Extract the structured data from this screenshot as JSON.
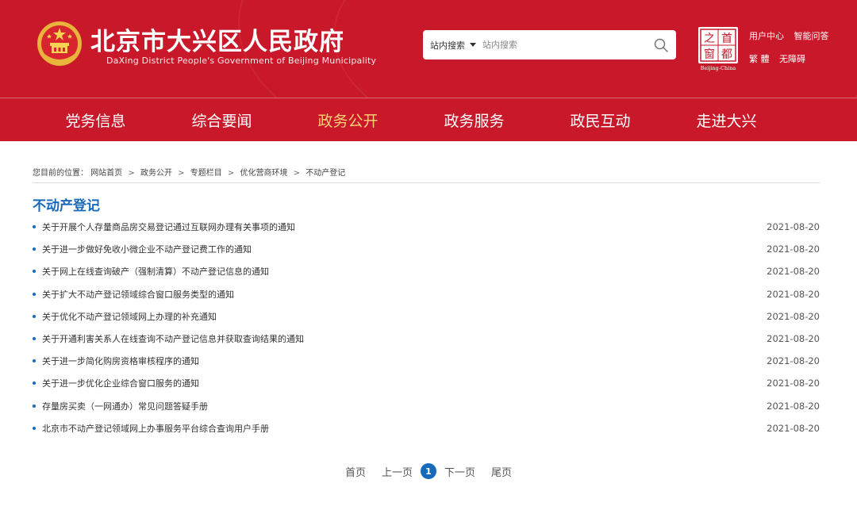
{
  "header": {
    "title": "北京市大兴区人民政府",
    "subtitle": "DaXing District People's Government of Beijing Municipality",
    "emblem_icon": "national-emblem-icon",
    "capital_seal": {
      "chars": [
        "首",
        "都",
        "之",
        "窗"
      ],
      "caption": "Beijing-China"
    },
    "search": {
      "scope_label": "站内搜索",
      "placeholder": "站内搜索",
      "icon": "search-icon"
    },
    "links": {
      "user_center": "用户中心",
      "smart_qa": "智能问答",
      "traditional": "繁 體",
      "accessibility": "无障碍"
    }
  },
  "nav": {
    "items": [
      {
        "label": "党务信息"
      },
      {
        "label": "综合要闻"
      },
      {
        "label": "政务公开",
        "active": true
      },
      {
        "label": "政务服务"
      },
      {
        "label": "政民互动"
      },
      {
        "label": "走进大兴"
      }
    ]
  },
  "breadcrumb": {
    "prefix": "您目前的位置：",
    "items": [
      "网站首页",
      "政务公开",
      "专题栏目",
      "优化营商环境",
      "不动产登记"
    ],
    "separator": ">"
  },
  "section": {
    "title": "不动产登记"
  },
  "list": [
    {
      "title": "关于开展个人存量商品房交易登记通过互联网办理有关事项的通知",
      "date": "2021-08-20"
    },
    {
      "title": "关于进一步做好免收小微企业不动产登记费工作的通知",
      "date": "2021-08-20"
    },
    {
      "title": "关于网上在线查询破产（强制清算）不动产登记信息的通知",
      "date": "2021-08-20"
    },
    {
      "title": "关于扩大不动产登记领域综合窗口服务类型的通知",
      "date": "2021-08-20"
    },
    {
      "title": "关于优化不动产登记领域网上办理的补充通知",
      "date": "2021-08-20"
    },
    {
      "title": "关于开通利害关系人在线查询不动产登记信息并获取查询结果的通知",
      "date": "2021-08-20"
    },
    {
      "title": "关于进一步简化购房资格审核程序的通知",
      "date": "2021-08-20"
    },
    {
      "title": "关于进一步优化企业综合窗口服务的通知",
      "date": "2021-08-20"
    },
    {
      "title": "存量房买卖（一网通办）常见问题答疑手册",
      "date": "2021-08-20"
    },
    {
      "title": "北京市不动产登记领域网上办事服务平台综合查询用户手册",
      "date": "2021-08-20"
    }
  ],
  "pager": {
    "first": "首页",
    "prev": "上一页",
    "current": "1",
    "next": "下一页",
    "last": "尾页"
  },
  "colors": {
    "brand_red": "#c8182a",
    "nav_active": "#ffd277",
    "link_blue": "#1769ba"
  }
}
